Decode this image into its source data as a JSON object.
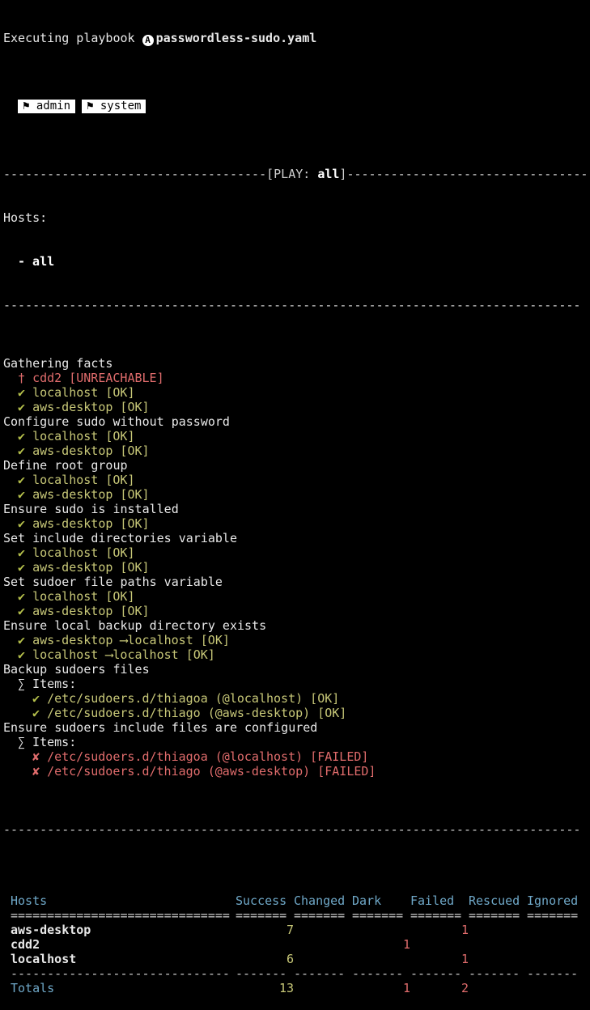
{
  "header": {
    "prefix": "Executing playbook",
    "logo_icon": "ansible-logo-icon",
    "playbook": "passwordless-sudo.yaml"
  },
  "tags": [
    "⚑ admin",
    "⚑ system"
  ],
  "play_rule_left": "------------------------------------[PLAY: ",
  "play_name": "all",
  "play_rule_right": "]------------------------------------",
  "hosts_label": "Hosts:",
  "hosts_item": "- all",
  "rule": "-------------------------------------------------------------------------------",
  "tasks": [
    {
      "name": "Gathering facts",
      "lines": [
        {
          "icon": "†",
          "text": "cdd2 [UNREACHABLE]",
          "status": "bad"
        },
        {
          "icon": "✔",
          "text": "localhost [OK]",
          "status": "ok"
        },
        {
          "icon": "✔",
          "text": "aws-desktop [OK]",
          "status": "ok"
        }
      ]
    },
    {
      "name": "Configure sudo without password",
      "lines": [
        {
          "icon": "✔",
          "text": "localhost [OK]",
          "status": "ok"
        },
        {
          "icon": "✔",
          "text": "aws-desktop [OK]",
          "status": "ok"
        }
      ]
    },
    {
      "name": "Define root group",
      "lines": [
        {
          "icon": "✔",
          "text": "localhost [OK]",
          "status": "ok"
        },
        {
          "icon": "✔",
          "text": "aws-desktop [OK]",
          "status": "ok"
        }
      ]
    },
    {
      "name": "Ensure sudo is installed",
      "lines": [
        {
          "icon": "✔",
          "text": "aws-desktop [OK]",
          "status": "ok"
        }
      ]
    },
    {
      "name": "Set include directories variable",
      "lines": [
        {
          "icon": "✔",
          "text": "localhost [OK]",
          "status": "ok"
        },
        {
          "icon": "✔",
          "text": "aws-desktop [OK]",
          "status": "ok"
        }
      ]
    },
    {
      "name": "Set sudoer file paths variable",
      "lines": [
        {
          "icon": "✔",
          "text": "localhost [OK]",
          "status": "ok"
        },
        {
          "icon": "✔",
          "text": "aws-desktop [OK]",
          "status": "ok"
        }
      ]
    },
    {
      "name": "Ensure local backup directory exists",
      "lines": [
        {
          "icon": "✔",
          "text": "aws-desktop ⟶localhost [OK]",
          "status": "ok"
        },
        {
          "icon": "✔",
          "text": "localhost ⟶localhost [OK]",
          "status": "ok"
        }
      ]
    },
    {
      "name": "Backup sudoers files",
      "items_label": "∑ Items:",
      "items": [
        {
          "icon": "✔",
          "text": "/etc/sudoers.d/thiagoa (@localhost) [OK]",
          "status": "ok"
        },
        {
          "icon": "✔",
          "text": "/etc/sudoers.d/thiago (@aws-desktop) [OK]",
          "status": "ok"
        }
      ]
    },
    {
      "name": "Ensure sudoers include files are configured",
      "items_label": "∑ Items:",
      "items": [
        {
          "icon": "✘",
          "text": "/etc/sudoers.d/thiagoa (@localhost) [FAILED]",
          "status": "bad"
        },
        {
          "icon": "✘",
          "text": "/etc/sudoers.d/thiago (@aws-desktop) [FAILED]",
          "status": "bad"
        }
      ]
    }
  ],
  "summary": {
    "columns": [
      "Hosts",
      "Success",
      "Changed",
      "Dark",
      "Failed",
      "Rescued",
      "Ignored"
    ],
    "header_rule": [
      "==============================",
      "=======",
      "=======",
      "=======",
      "=======",
      "=======",
      "======="
    ],
    "rows": [
      {
        "host": "aws-desktop",
        "success": "7",
        "changed": "",
        "dark": "",
        "failed": "1",
        "rescued": "",
        "ignored": ""
      },
      {
        "host": "cdd2",
        "success": "",
        "changed": "",
        "dark": "1",
        "failed": "",
        "rescued": "",
        "ignored": ""
      },
      {
        "host": "localhost",
        "success": "6",
        "changed": "",
        "dark": "",
        "failed": "1",
        "rescued": "",
        "ignored": ""
      }
    ],
    "footer_rule": [
      "------------------------------",
      "-------",
      "-------",
      "-------",
      "-------",
      "-------",
      "-------"
    ],
    "totals": {
      "host": "Totals",
      "success": "13",
      "changed": "",
      "dark": "1",
      "failed": "2",
      "rescued": "",
      "ignored": ""
    }
  },
  "colors": {
    "ok": "#c8c878",
    "bad": "#e06c6c",
    "check": "#b5c04b",
    "header": "#6fa8c8",
    "background": "#000000"
  }
}
